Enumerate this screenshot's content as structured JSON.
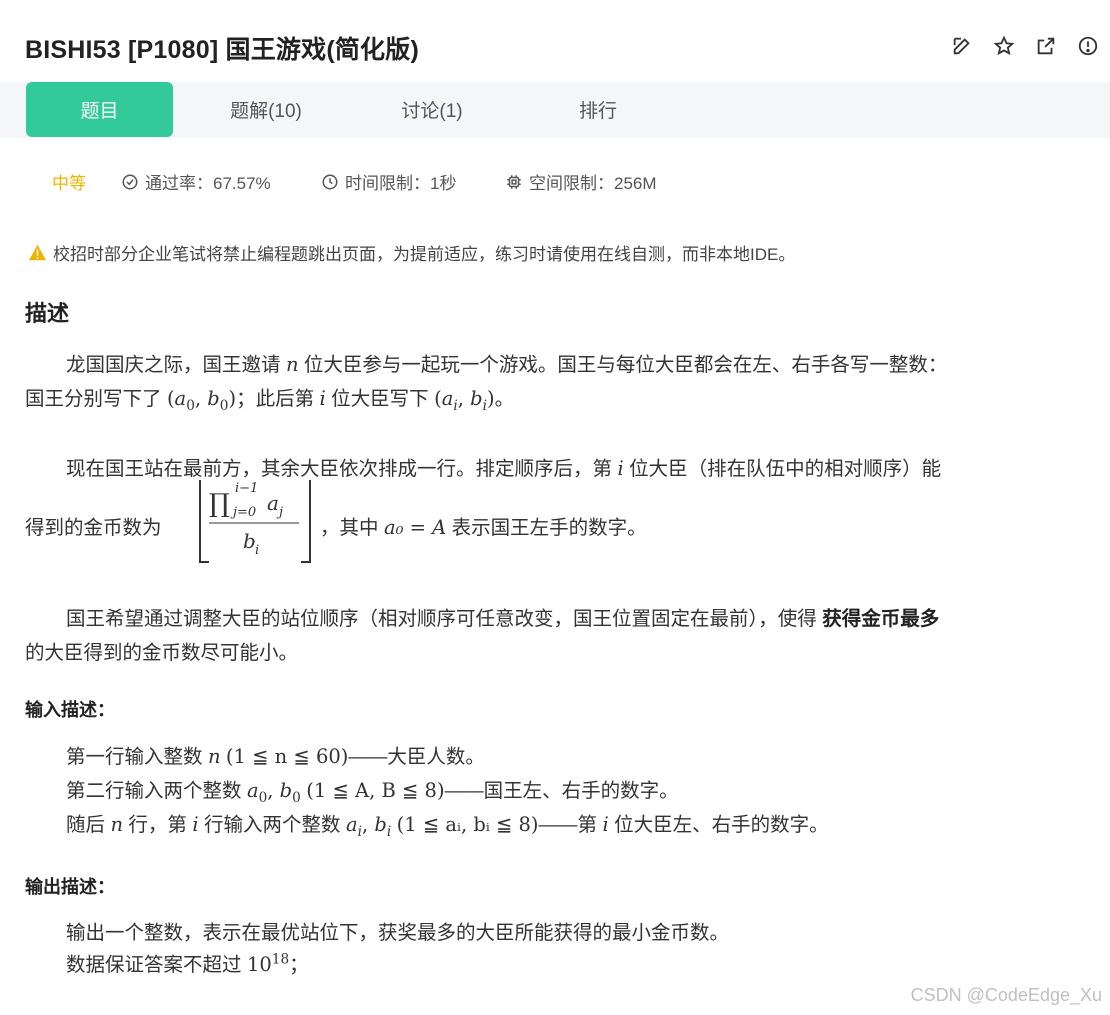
{
  "header": {
    "title": "BISHI53  [P1080] 国王游戏(简化版)",
    "icons": [
      "edit-icon",
      "star-icon",
      "external-link-icon",
      "info-icon"
    ]
  },
  "tabs": [
    {
      "label": "题目",
      "active": true
    },
    {
      "label": "题解(10)",
      "active": false
    },
    {
      "label": "讨论(1)",
      "active": false
    },
    {
      "label": "排行",
      "active": false
    }
  ],
  "meta": {
    "difficulty": "中等",
    "pass_rate": "通过率：67.57%",
    "time_limit": "时间限制：1秒",
    "space_limit": "空间限制：256M"
  },
  "notice": "校招时部分企业笔试将禁止编程题跳出页面，为提前适应，练习时请使用在线自测，而非本地IDE。",
  "description": {
    "heading": "描述",
    "p1_a": "龙国国庆之际，国王邀请",
    "p1_n": "n",
    "p1_b": "位大臣参与一起玩一个游戏。国王与每位大臣都会在左、右手各写一整数：",
    "p1_c": "国王分别写下了",
    "p1_d": "；此后第",
    "p1_i": "i",
    "p1_e": "位大臣写下",
    "p1_f": "。",
    "p2_a": "现在国王站在最前方，其余大臣依次排成一行。排定顺序后，第",
    "p2_i": "i",
    "p2_b": "位大臣（排在队伍中的相对顺序）能",
    "p2_c": "得到的金币数为",
    "p2_d": "，其中",
    "p2_eq": "a₀ = A",
    "p2_e": "表示国王左手的数字。",
    "p3_a": "国王希望通过调整大臣的站位顺序（相对顺序可任意改变，国王位置固定在最前），使得",
    "p3_bold": "获得金币最多",
    "p3_b": "的大臣得到的金币数尽可能小。"
  },
  "input": {
    "heading": "输入描述：",
    "l1_a": "第一行输入整数",
    "l1_m": "(1 ≦ n ≦ 60)",
    "l1_b": "——大臣人数。",
    "l2_a": "第二行输入两个整数",
    "l2_m": "(1 ≦ A, B ≦ 8)",
    "l2_b": "——国王左、右手的数字。",
    "l3_a": "随后",
    "l3_b": "行，第",
    "l3_c": "行输入两个整数",
    "l3_m": "(1 ≦ aᵢ, bᵢ ≦ 8)",
    "l3_d": "——第",
    "l3_e": "位大臣左、右手的数字。"
  },
  "output": {
    "heading": "输出描述：",
    "l1": "输出一个整数，表示在最优站位下，获奖最多的大臣所能获得的最小金币数。",
    "l2_a": "数据保证答案不超过",
    "l2_base": "10",
    "l2_exp": "18",
    "l2_b": "；"
  },
  "watermark": "CSDN @CodeEdge_Xu",
  "colors": {
    "accent": "#32ca99",
    "difficulty": "#f0b400",
    "warning": "#f0b400"
  }
}
